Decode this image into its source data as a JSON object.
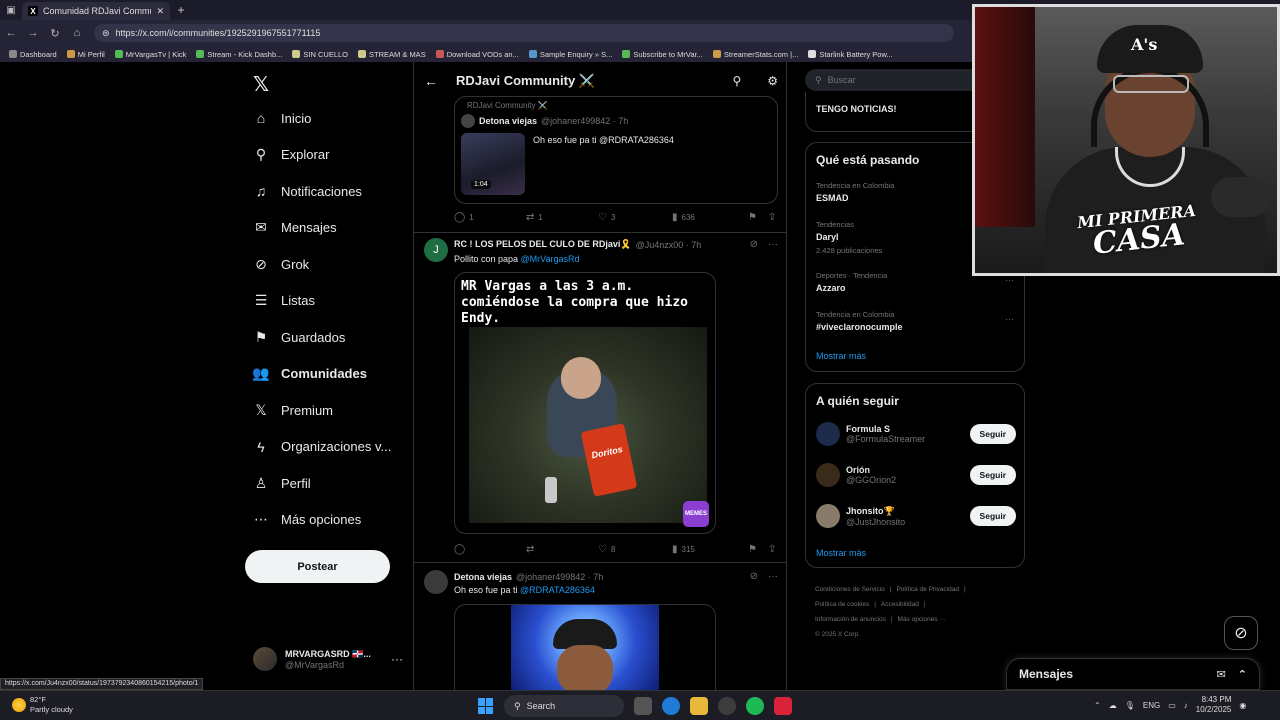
{
  "browser": {
    "tab_title": "Comunidad RDJavi Community",
    "url": "https://x.com/i/communities/1925291967551771115",
    "bookmarks": [
      "Dashboard",
      "Mi Perfil",
      "MrVargasTv | Kick",
      "Stream - Kick Dashb...",
      "SIN CUELLO",
      "STREAM & MAS",
      "Download VODs an...",
      "Sample Enquiry » S...",
      "Subscribe to MrVar...",
      "StreamerStats.com |...",
      "Starlink Battery Pow..."
    ],
    "status_url": "https://x.com/Ju4nzx00/status/1973792340860154215/photo/1"
  },
  "nav": {
    "items": [
      {
        "label": "Inicio",
        "icon": "home-icon",
        "glyph": "⌂"
      },
      {
        "label": "Explorar",
        "icon": "search-icon",
        "glyph": "⚲"
      },
      {
        "label": "Notificaciones",
        "icon": "bell-icon",
        "glyph": "♫"
      },
      {
        "label": "Mensajes",
        "icon": "mail-icon",
        "glyph": "✉"
      },
      {
        "label": "Grok",
        "icon": "grok-icon",
        "glyph": "⊘"
      },
      {
        "label": "Listas",
        "icon": "list-icon",
        "glyph": "☰"
      },
      {
        "label": "Guardados",
        "icon": "bookmark-icon",
        "glyph": "⚑"
      },
      {
        "label": "Comunidades",
        "icon": "communities-icon",
        "glyph": "👥"
      },
      {
        "label": "Premium",
        "icon": "x-premium-icon",
        "glyph": "𝕏"
      },
      {
        "label": "Organizaciones v...",
        "icon": "lightning-icon",
        "glyph": "ϟ"
      },
      {
        "label": "Perfil",
        "icon": "person-icon",
        "glyph": "♙"
      },
      {
        "label": "Más opciones",
        "icon": "more-circle-icon",
        "glyph": "⋯"
      }
    ],
    "post_label": "Postear",
    "profile_name": "MRVARGASRD 🇩🇴...",
    "profile_handle": "@MrVargasRd"
  },
  "center": {
    "title": "RDJavi Community ⚔️",
    "quote": {
      "community": "RDJavi Community ⚔️",
      "author": "Detona viejas",
      "handle_time": "@johaner499842 · 7h",
      "duration": "1:04",
      "text": "Oh eso fue pa ti @RDRATA286364"
    },
    "actions1": {
      "replies": "1",
      "reposts": "1",
      "likes": "3",
      "views": "636"
    },
    "tweet2": {
      "author": "RC ! LOS PELOS DEL CULO DE RDjavi🎗️",
      "handle_time": "@Ju4nzx00 · 7h",
      "text_pre": "Pollito con papa ",
      "mention": "@MrVargasRd",
      "meme_caption": "MR Vargas a las 3 a.m. comiéndose la compra que hizo Endy.",
      "bag_text": "Doritos",
      "badge": "MEMES"
    },
    "actions2": {
      "replies": "",
      "reposts": "",
      "likes": "8",
      "views": "315"
    },
    "tweet3": {
      "author": "Detona viejas",
      "handle_time": "@johaner499842 · 7h",
      "text_pre": "Oh eso fue pa ti ",
      "mention": "@RDRATA286364"
    }
  },
  "right": {
    "search_placeholder": "Buscar",
    "news_title": "TENGO NOTICIAS!",
    "trends_title": "Qué está pasando",
    "trends": [
      {
        "category": "Tendencia en Colombia",
        "name": "ESMAD",
        "count": ""
      },
      {
        "category": "Tendencias",
        "name": "Daryl",
        "count": "2.428 publicaciones"
      },
      {
        "category": "Deportes · Tendencia",
        "name": "Azzaro",
        "count": ""
      },
      {
        "category": "Tendencia en Colombia",
        "name": "#viveclaronocumple",
        "count": ""
      }
    ],
    "show_more": "Mostrar más",
    "follow_title": "A quién seguir",
    "follow": [
      {
        "name": "Formula S",
        "handle": "@FormulaStreamer",
        "button": "Seguir",
        "color": "#1c2b4a"
      },
      {
        "name": "Orión",
        "handle": "@GGOrion2",
        "button": "Seguir",
        "color": "#3a2a1a"
      },
      {
        "name": "Jhonsito🏆",
        "handle": "@JustJhonsito",
        "button": "Seguir",
        "color": "#8a7a6a"
      }
    ],
    "footer": [
      "Condiciones de Servicio",
      "|",
      "Política de Privacidad",
      "|",
      "Política de cookies",
      "|",
      "Accesibilidad",
      "|",
      "Información de anuncios",
      "|",
      "Más opciones ···",
      "© 2025 X Corp."
    ]
  },
  "webcam": {
    "cap_letters": "A's",
    "brand_line1": "MI PRIMERA",
    "brand_line2": "CASA"
  },
  "messages_drawer": {
    "title": "Mensajes"
  },
  "taskbar": {
    "temp": "82°F",
    "weather": "Partly cloudy",
    "search": "Search",
    "lang": "ENG",
    "time": "8:43 PM",
    "date": "10/2/2025"
  }
}
